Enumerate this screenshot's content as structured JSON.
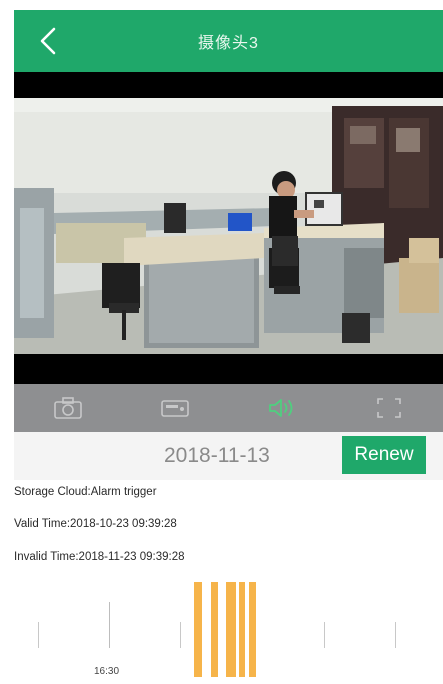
{
  "header": {
    "title": "摄像头3",
    "back_icon": "chevron-left-icon"
  },
  "toolbar": {
    "items": [
      {
        "icon": "camera-icon"
      },
      {
        "icon": "video-record-icon"
      },
      {
        "icon": "speaker-icon"
      },
      {
        "icon": "fullscreen-icon"
      }
    ],
    "active_color": "#4fcf7f"
  },
  "date_row": {
    "date": "2018-11-13",
    "renew_label": "Renew"
  },
  "storage": {
    "line1": "Storage Cloud:Alarm trigger",
    "line2": "Valid Time:2018-10-23 09:39:28",
    "line3": "Invalid Time:2018-11-23 09:39:28"
  },
  "timeline": {
    "tick_label": "16:30"
  },
  "colors": {
    "brand": "#1fa86a",
    "recording": "#f6b44a"
  }
}
